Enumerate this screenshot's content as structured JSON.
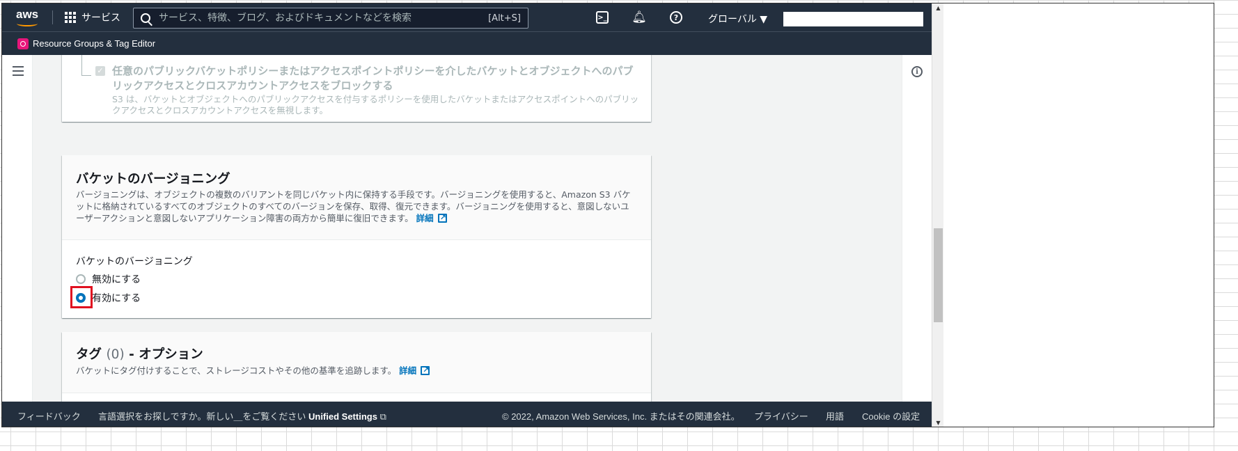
{
  "topnav": {
    "logo_text": "aws",
    "services_label": "サービス",
    "search_placeholder": "サービス、特徴、ブログ、およびドキュメントなどを検索",
    "search_shortcut": "[Alt+S]",
    "region_label": "グローバル ▼"
  },
  "subnav": {
    "app_name": "Resource Groups & Tag Editor"
  },
  "block_panel": {
    "checkbox_title": "任意のパブリックバケットポリシーまたはアクセスポイントポリシーを介したバケットとオブジェクトへのパブリックアクセスとクロスアカウントアクセスをブロックする",
    "checkbox_desc": "S3 は、バケットとオブジェクトへのパブリックアクセスを付与するポリシーを使用したバケットまたはアクセスポイントへのパブリックアクセスとクロスアカウントアクセスを無視します。"
  },
  "versioning_panel": {
    "title": "バケットのバージョニング",
    "description": "バージョニングは、オブジェクトの複数のバリアントを同じバケット内に保持する手段です。バージョニングを使用すると、Amazon S3 バケットに格納されているすべてのオブジェクトのすべてのバージョンを保存、取得、復元できます。バージョニングを使用すると、意図しないユーザーアクションと意図しないアプリケーション障害の両方から簡単に復旧できます。",
    "learn_more": "詳細",
    "field_label": "バケットのバージョニング",
    "options": [
      {
        "label": "無効にする",
        "selected": false
      },
      {
        "label": "有効にする",
        "selected": true
      }
    ]
  },
  "tags_panel": {
    "title": "タグ",
    "count": "(0)",
    "suffix": "- オプション",
    "description": "バケットにタグ付けすることで、ストレージコストやその他の基準を追跡します。",
    "learn_more": "詳細"
  },
  "footer": {
    "feedback": "フィードバック",
    "language_prompt": "言語選択をお探しですか。新しい＿をご覧ください",
    "unified_settings": "Unified Settings",
    "copyright": "© 2022, Amazon Web Services, Inc. またはその関連会社。",
    "privacy": "プライバシー",
    "terms": "用語",
    "cookie": "Cookie の設定"
  },
  "colors": {
    "nav_bg": "#232f3e",
    "link": "#0073bb",
    "highlight": "#e01020",
    "brand_orange": "#ff9900"
  }
}
